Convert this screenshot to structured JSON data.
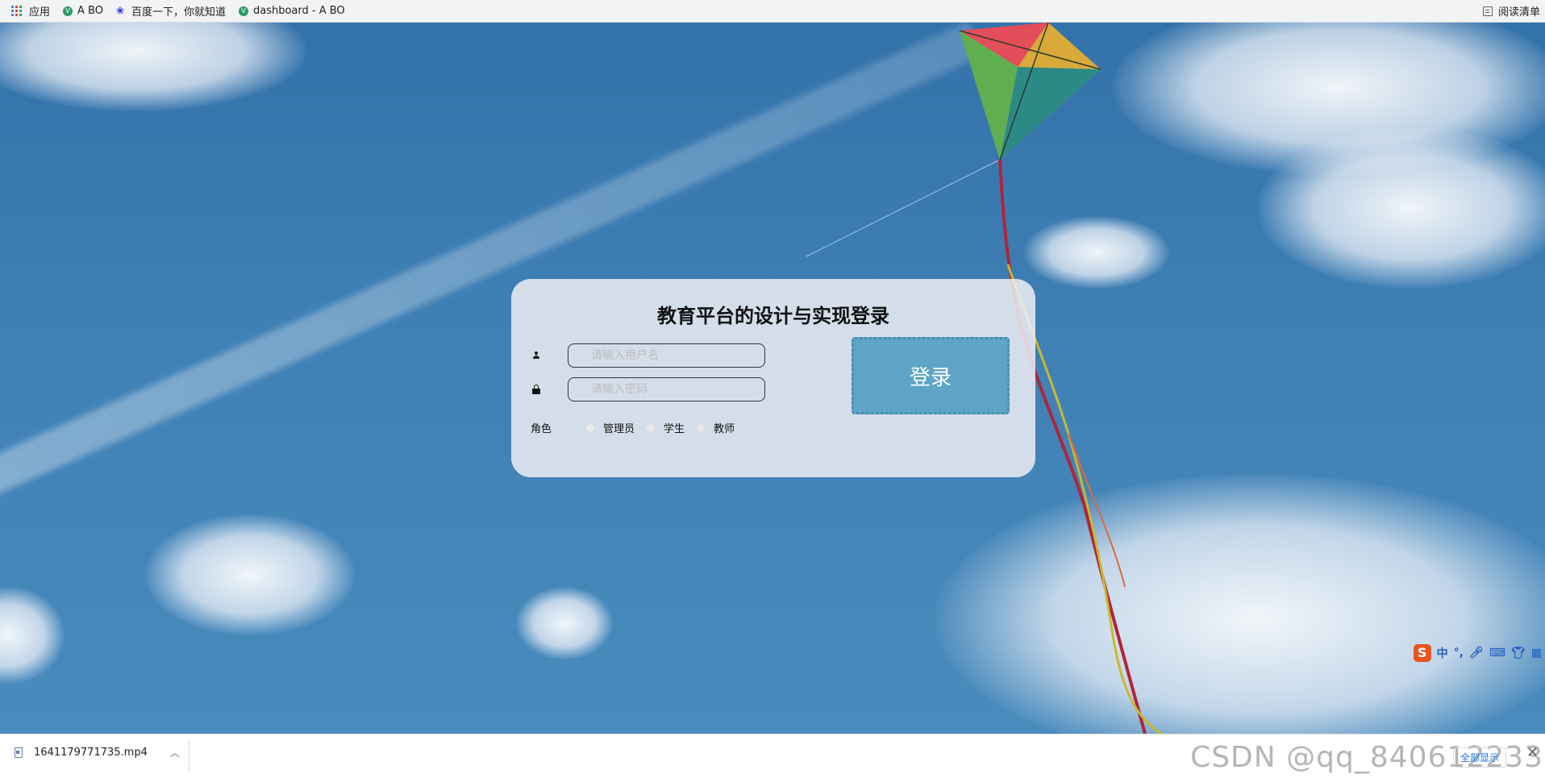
{
  "bookmarks": {
    "items": [
      {
        "label": "应用",
        "icon": "apps-grid-icon"
      },
      {
        "label": "A BO",
        "icon": "vue-icon"
      },
      {
        "label": "百度一下，你就知道",
        "icon": "baidu-paw-icon"
      },
      {
        "label": "dashboard - A BO",
        "icon": "vue-icon"
      }
    ],
    "reading_list": "阅读清单"
  },
  "login": {
    "title": "教育平台的设计与实现登录",
    "username_placeholder": "请输入用户名",
    "password_placeholder": "请输入密码",
    "role_label": "角色",
    "roles": [
      "管理员",
      "学生",
      "教师"
    ],
    "submit_label": "登录"
  },
  "ime": {
    "logo": "S",
    "mode": "中",
    "punct": "°,"
  },
  "downloads": {
    "file_name": "1641179771735.mp4",
    "show_all": "全部显示"
  },
  "watermark": "CSDN @qq_840612233",
  "colors": {
    "button_bg": "#5ea4c6",
    "card_bg": "#eceef2",
    "sky": "#3d7fb2"
  }
}
